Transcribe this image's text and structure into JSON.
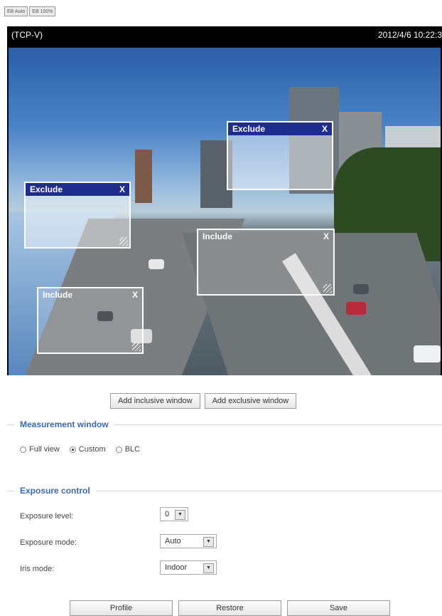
{
  "toolbar": {
    "btn1": "EB Auto",
    "btn2": "EB 100%"
  },
  "viewer": {
    "title": "(TCP-V)",
    "timestamp": "2012/4/6 10:22:3"
  },
  "windows": [
    {
      "label": "Exclude",
      "close": "X",
      "type": "exclude"
    },
    {
      "label": "Exclude",
      "close": "X",
      "type": "exclude"
    },
    {
      "label": "Include",
      "close": "X",
      "type": "include"
    },
    {
      "label": "Include",
      "close": "X",
      "type": "include"
    }
  ],
  "window_buttons": {
    "add_inclusive": "Add inclusive window",
    "add_exclusive": "Add exclusive window"
  },
  "measurement": {
    "title": "Measurement window",
    "options": [
      "Full view",
      "Custom",
      "BLC"
    ],
    "selected": "Custom"
  },
  "exposure": {
    "title": "Exposure control",
    "level_label": "Exposure level:",
    "level_value": "0",
    "mode_label": "Exposure mode:",
    "mode_value": "Auto",
    "iris_label": "Iris mode:",
    "iris_value": "Indoor",
    "dropdown_icon": "chevron-down-icon"
  },
  "actions": {
    "profile": "Profile",
    "restore": "Restore",
    "save": "Save"
  }
}
